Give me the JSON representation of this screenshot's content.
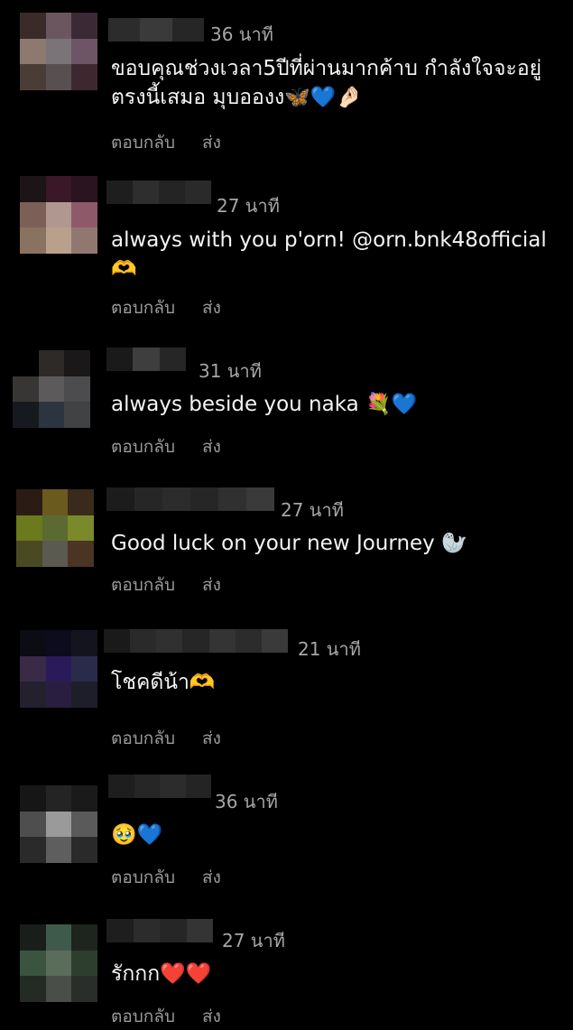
{
  "comments": [
    {
      "time": "36 นาที",
      "text": "ขอบคุณช่วงเวลา5ปีที่ผ่านมากค้าบ กำลังใจจะอยู่ตรงนี้เสมอ มุบอองง🦋💙🤌🏻",
      "reply": "ตอบกลับ",
      "send": "ส่ง",
      "avatar_colors": [
        "#3a2a2a",
        "#6b5660",
        "#3b2a35",
        "#8c7a70",
        "#7a7378",
        "#6e5565",
        "#4a3d35",
        "#585050",
        "#3e2830"
      ]
    },
    {
      "time": "27 นาที",
      "text": "always with you p'orn! @orn.bnk48official 🫶",
      "reply": "ตอบกลับ",
      "send": "ส่ง",
      "avatar_colors": [
        "#1c1416",
        "#3a1828",
        "#2a1420",
        "#7c6058",
        "#b09890",
        "#8e5a6a",
        "#8a7260",
        "#b8a08a",
        "#907870"
      ]
    },
    {
      "time": "31 นาที",
      "text": "always beside you naka 💐💙",
      "reply": "ตอบกลับ",
      "send": "ส่ง",
      "avatar_colors": [
        "#000",
        "#2e2a28",
        "#1a1818",
        "#383634",
        "#5c5a5a",
        "#4c4c4e",
        "#161a1e",
        "#2c3440",
        "#404244"
      ]
    },
    {
      "time": "27 นาที",
      "text": "Good luck on your new Journey 🦭",
      "reply": "ตอบกลับ",
      "send": "ส่ง",
      "avatar_colors": [
        "#2a1c14",
        "#6a5a1e",
        "#3a2a1c",
        "#6a7a1c",
        "#5a6a30",
        "#7a8a2a",
        "#4a4a22",
        "#5a5a50",
        "#4a3424"
      ]
    },
    {
      "time": "21 นาที",
      "text": "โชคดีน้า🫶",
      "reply": "ตอบกลับ",
      "send": "ส่ง",
      "avatar_colors": [
        "#0c0c14",
        "#0c0c1e",
        "#14141e",
        "#3a2a48",
        "#2a1a5a",
        "#2a2a4a",
        "#24202e",
        "#2a1e40",
        "#1e1e2a"
      ]
    },
    {
      "time": "36 นาที",
      "text": "🥹💙",
      "reply": "ตอบกลับ",
      "send": "ส่ง",
      "avatar_colors": [
        "#161616",
        "#242424",
        "#1a1a1a",
        "#4e4e4e",
        "#9a9a9a",
        "#5a5a5a",
        "#2a2a2a",
        "#5e5e5e",
        "#2a2a2a"
      ]
    },
    {
      "time": "27 นาที",
      "text": "รักกก❤️❤️",
      "reply": "ตอบกลับ",
      "send": "ส่ง",
      "avatar_colors": [
        "#1a1e1a",
        "#3e5a4a",
        "#1e241e",
        "#3a5440",
        "#5a6c5a",
        "#2e3e2e",
        "#242a24",
        "#4a4e48",
        "#2a2e2a"
      ]
    }
  ]
}
